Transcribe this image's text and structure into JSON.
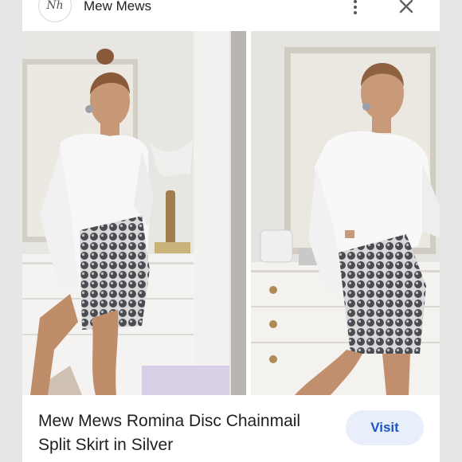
{
  "header": {
    "logo_text": "Nh",
    "brand_name": "Mew Mews"
  },
  "caption": {
    "title_line1": "Mew Mews Romina Disc Chainmail",
    "title_line2": "Split Skirt in Silver"
  },
  "actions": {
    "visit_label": "Visit"
  },
  "icons": {
    "more": "more-vert-icon",
    "close": "close-icon"
  },
  "colors": {
    "visit_bg": "#e8effb",
    "visit_text": "#1a56c8"
  }
}
